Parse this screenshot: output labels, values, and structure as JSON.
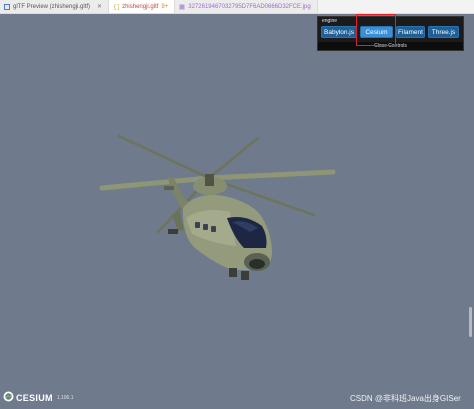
{
  "tabs": [
    {
      "label": "glTF Preview (zhishengji.gltf)",
      "active": false
    },
    {
      "label": "zhishengji.gltf",
      "modified": "9+",
      "active": true
    },
    {
      "label": "3272619467032795D7F6AD0666D32FCE.jpg",
      "active": false
    }
  ],
  "engine_panel": {
    "title": "engine",
    "buttons": [
      "Babylon.js",
      "Cesium",
      "Filament",
      "Three.js"
    ],
    "selected": "Cesium",
    "close_label": "Close Controls"
  },
  "footer": {
    "logo_text": "CESIUM",
    "version": "1.106.1",
    "watermark": "CSDN @非科班Java出身GISer"
  },
  "colors": {
    "viewer_background": "#6f7a8c",
    "selected_highlight": "#e0212a",
    "button_blue": "#1f5f96"
  }
}
